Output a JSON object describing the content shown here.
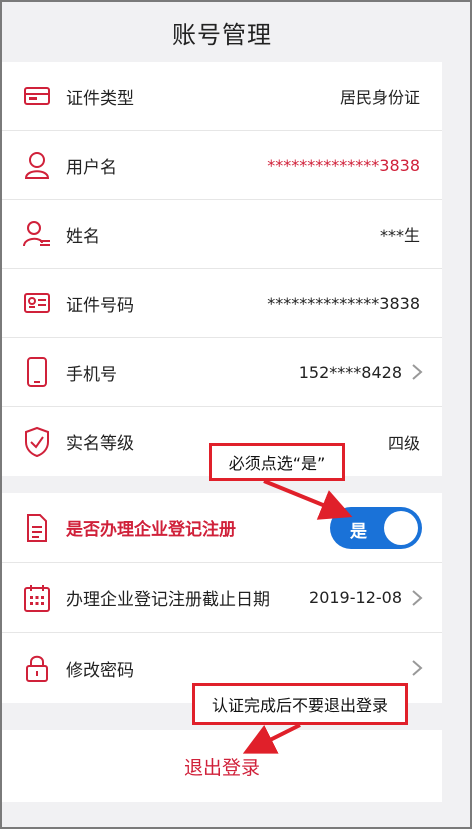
{
  "header": {
    "title": "账号管理"
  },
  "rows": [
    {
      "label": "证件类型",
      "value": "居民身份证"
    },
    {
      "label": "用户名",
      "value": "**************3838"
    },
    {
      "label": "姓名",
      "value": "***生"
    },
    {
      "label": "证件号码",
      "value": "**************3838"
    },
    {
      "label": "手机号",
      "value": "152****8428"
    },
    {
      "label": "实名等级",
      "value": "四级"
    }
  ],
  "rows2": [
    {
      "label": "是否办理企业登记注册",
      "toggle_text": "是",
      "toggle_on": true
    },
    {
      "label": "办理企业登记注册截止日期",
      "value": "2019-12-08"
    },
    {
      "label": "修改密码"
    }
  ],
  "logout": {
    "label": "退出登录"
  },
  "annotations": {
    "must_click": "必须点选“是”",
    "no_logout": "认证完成后不要退出登录"
  },
  "colors": {
    "accent_red": "#d0213a",
    "toggle_blue": "#1a72d8",
    "annotation_red": "#e0202a"
  }
}
